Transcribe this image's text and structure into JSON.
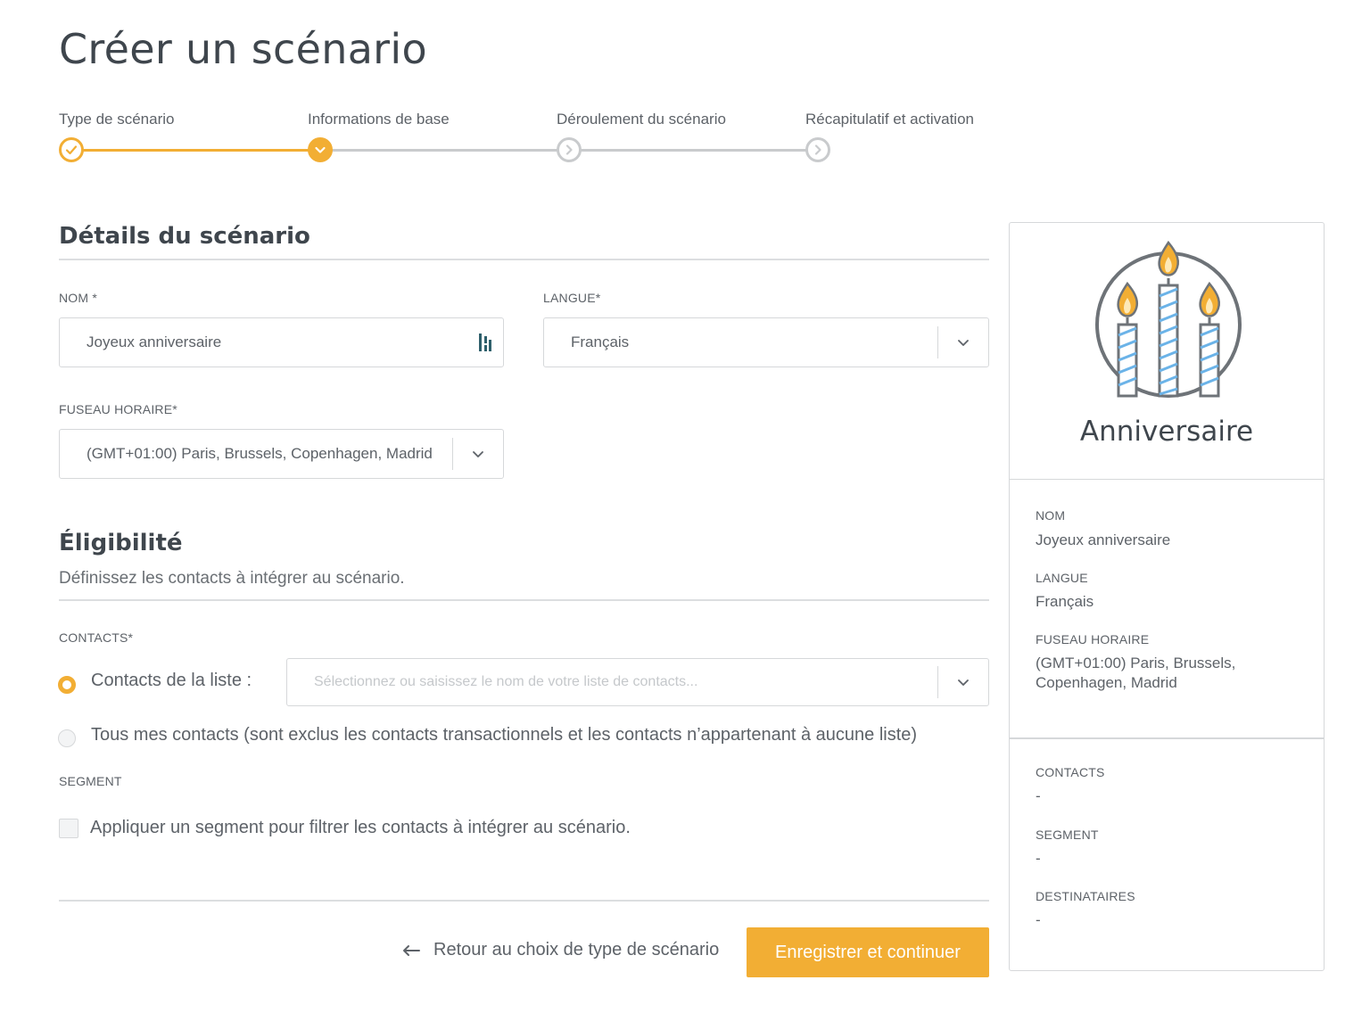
{
  "page": {
    "title": "Créer un scénario"
  },
  "stepper": {
    "steps": [
      {
        "label": "Type de scénario",
        "state": "done"
      },
      {
        "label": "Informations de base",
        "state": "current"
      },
      {
        "label": "Déroulement du scénario",
        "state": "todo"
      },
      {
        "label": "Récapitulatif et activation",
        "state": "todo"
      }
    ]
  },
  "details": {
    "title": "Détails du scénario",
    "name_label": "NOM *",
    "name_value": "Joyeux anniversaire",
    "language_label": "LANGUE*",
    "language_value": "Français",
    "timezone_label": "FUSEAU HORAIRE*",
    "timezone_value": "(GMT+01:00) Paris, Brussels, Copenhagen, Madrid"
  },
  "eligibility": {
    "title": "Éligibilité",
    "subtitle": "Définissez les contacts à intégrer au scénario.",
    "contacts_label": "CONTACTS*",
    "option_list_label": "Contacts de la liste :",
    "list_placeholder": "Sélectionnez ou saisissez le nom de votre liste de contacts...",
    "option_all_label": "Tous mes contacts (sont exclus les contacts transactionnels et les contacts n’appartenant à aucune liste)",
    "segment_label": "SEGMENT",
    "segment_checkbox_label": "Appliquer un segment pour filtrer les contacts à intégrer au scénario."
  },
  "footer": {
    "back_label": "Retour au choix de type de scénario",
    "submit_label": "Enregistrer et continuer"
  },
  "summary": {
    "type_title": "Anniversaire",
    "name_label": "NOM",
    "name_value": "Joyeux anniversaire",
    "language_label": "LANGUE",
    "language_value": "Français",
    "timezone_label": "FUSEAU HORAIRE",
    "timezone_value": "(GMT+01:00) Paris, Brussels, Copenhagen, Madrid",
    "contacts_label": "CONTACTS",
    "contacts_value": "-",
    "segment_label": "SEGMENT",
    "segment_value": "-",
    "recipients_label": "DESTINATAIRES",
    "recipients_value": "-"
  },
  "colors": {
    "accent": "#f2ae34",
    "text": "#5d6268",
    "border": "#d6d8da"
  },
  "icons": {
    "step_done": "check-icon",
    "step_todo": "chevron-right-icon",
    "dropdown": "chevron-down-icon",
    "field_extension": "extension-icon",
    "back": "arrow-left-icon",
    "illustration": "birthday-candles-icon"
  }
}
